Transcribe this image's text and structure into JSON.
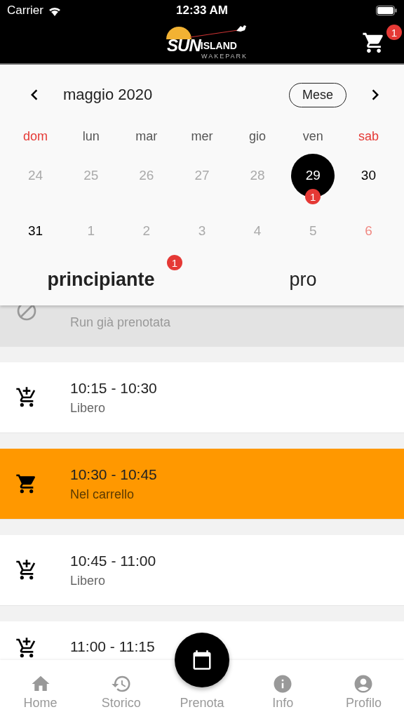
{
  "status_bar": {
    "carrier": "Carrier",
    "time": "12:33 AM"
  },
  "header": {
    "logo": {
      "main": "SUN",
      "second": "ISLAND",
      "sub": "WAKEPARK"
    },
    "cart_badge": "1"
  },
  "calendar": {
    "month": "maggio 2020",
    "view_button": "Mese",
    "weekdays": [
      {
        "label": "dom",
        "holiday": true
      },
      {
        "label": "lun",
        "holiday": false
      },
      {
        "label": "mar",
        "holiday": false
      },
      {
        "label": "mer",
        "holiday": false
      },
      {
        "label": "gio",
        "holiday": false
      },
      {
        "label": "ven",
        "holiday": false
      },
      {
        "label": "sab",
        "holiday": true
      }
    ],
    "weeks": [
      [
        {
          "day": "24",
          "outside": true,
          "holiday": false,
          "selected": false
        },
        {
          "day": "25",
          "outside": true,
          "holiday": false,
          "selected": false
        },
        {
          "day": "26",
          "outside": true,
          "holiday": false,
          "selected": false
        },
        {
          "day": "27",
          "outside": true,
          "holiday": false,
          "selected": false
        },
        {
          "day": "28",
          "outside": true,
          "holiday": false,
          "selected": false
        },
        {
          "day": "29",
          "outside": false,
          "holiday": false,
          "selected": true,
          "badge": "1"
        },
        {
          "day": "30",
          "outside": false,
          "holiday": false,
          "selected": false
        }
      ],
      [
        {
          "day": "31",
          "outside": false,
          "holiday": false,
          "selected": false
        },
        {
          "day": "1",
          "outside": true,
          "holiday": false,
          "selected": false
        },
        {
          "day": "2",
          "outside": true,
          "holiday": false,
          "selected": false
        },
        {
          "day": "3",
          "outside": true,
          "holiday": false,
          "selected": false
        },
        {
          "day": "4",
          "outside": true,
          "holiday": false,
          "selected": false
        },
        {
          "day": "5",
          "outside": true,
          "holiday": false,
          "selected": false
        },
        {
          "day": "6",
          "outside": true,
          "holiday": true,
          "selected": false
        }
      ]
    ]
  },
  "tabs": [
    {
      "label": "principiante",
      "selected": true,
      "badge": "1"
    },
    {
      "label": "pro",
      "selected": false
    }
  ],
  "slots": [
    {
      "kind": "booked",
      "status": "Run già prenotata"
    },
    {
      "kind": "free",
      "time": "10:15 - 10:30",
      "status": "Libero"
    },
    {
      "kind": "in-cart",
      "time": "10:30 - 10:45",
      "status": "Nel carrello"
    },
    {
      "kind": "free",
      "time": "10:45 - 11:00",
      "status": "Libero"
    },
    {
      "kind": "free",
      "time": "11:00 - 11:15"
    }
  ],
  "bottom_nav": [
    {
      "kind": "home",
      "label": "Home"
    },
    {
      "kind": "history",
      "label": "Storico"
    },
    {
      "kind": "book",
      "label": "Prenota"
    },
    {
      "kind": "info",
      "label": "Info"
    },
    {
      "kind": "profile",
      "label": "Profilo"
    }
  ]
}
